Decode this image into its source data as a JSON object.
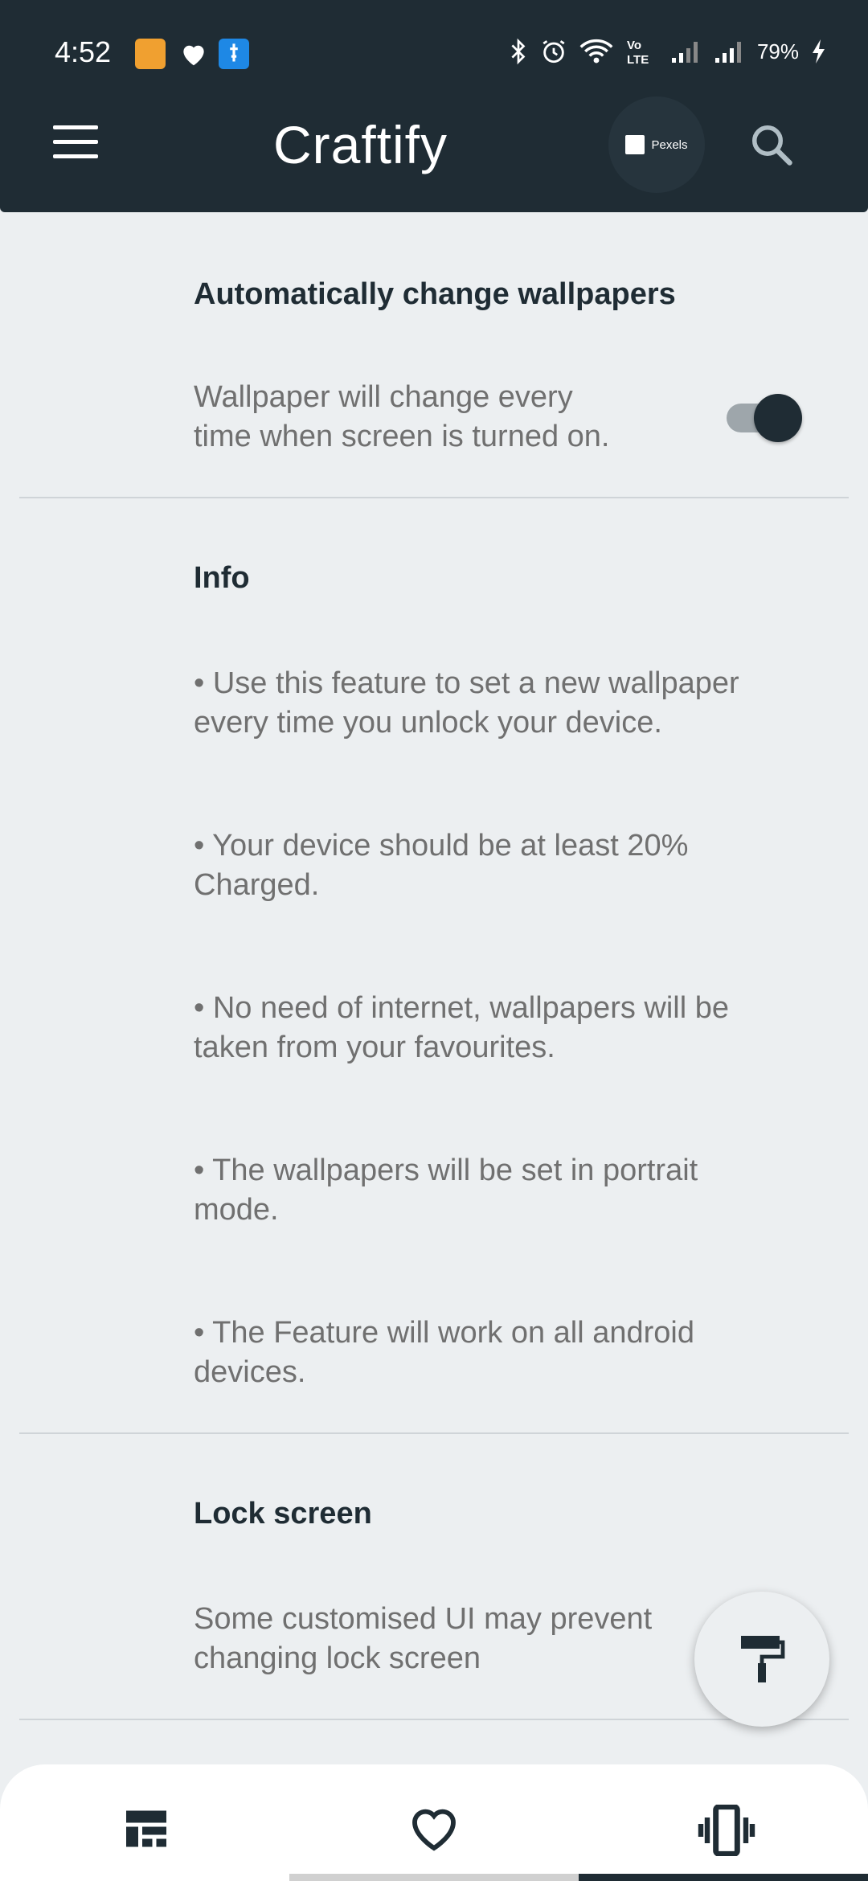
{
  "status_bar": {
    "time": "4:52",
    "battery_percent": "79%",
    "icons": [
      "bluetooth-icon",
      "alarm-icon",
      "wifi-icon",
      "volte-icon",
      "signal-icon",
      "signal-icon",
      "charging-icon"
    ]
  },
  "app_bar": {
    "title": "Craftify",
    "pexels_label": "Pexels",
    "menu_icon": "menu-icon",
    "search_icon": "search-icon"
  },
  "auto_change": {
    "title": "Automatically change wallpapers",
    "description_line1": "Wallpaper will change every",
    "description_line2": "time when screen is turned on.",
    "enabled": true
  },
  "info": {
    "title": "Info",
    "items": [
      {
        "line1": "• Use this feature to set a new wallpaper",
        "line2": "every time you unlock your device."
      },
      {
        "line1": "• Your device should be at least 20%",
        "line2": "Charged."
      },
      {
        "line1": "• No need of internet, wallpapers will be",
        "line2": "taken from your favourites."
      },
      {
        "line1": "• The wallpapers will be set in portrait",
        "line2": "mode."
      },
      {
        "line1": "• The Feature will work on all android",
        "line2": "devices."
      }
    ]
  },
  "lock_screen": {
    "title": "Lock screen",
    "description_line1": "Some customised UI may prevent",
    "description_line2": "changing lock screen"
  },
  "fab": {
    "icon": "paint-roller-icon"
  },
  "bottom_nav": {
    "items": [
      {
        "icon": "dashboard-icon"
      },
      {
        "icon": "heart-icon"
      },
      {
        "icon": "phone-vibrate-icon"
      }
    ],
    "active_index": 2
  },
  "colors": {
    "primary": "#1f2c34",
    "background": "#eceff1",
    "text_secondary": "#707070"
  }
}
